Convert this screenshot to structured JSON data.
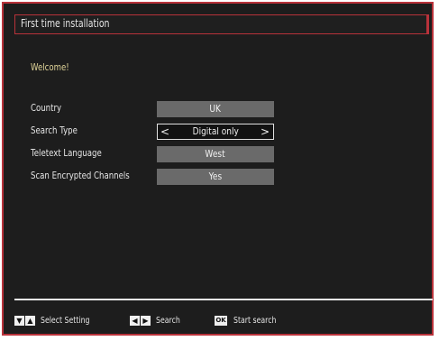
{
  "window": {
    "title": "First time installation",
    "welcome": "Welcome!"
  },
  "settings": [
    {
      "label": "Country",
      "value": "UK",
      "selected": false
    },
    {
      "label": "Search Type",
      "value": "Digital only",
      "selected": true,
      "arrow_left": "<",
      "arrow_right": ">"
    },
    {
      "label": "Teletext Language",
      "value": "West",
      "selected": false
    },
    {
      "label": "Scan Encrypted Channels",
      "value": "Yes",
      "selected": false
    }
  ],
  "footer": {
    "select_setting": {
      "keys": [
        "▼",
        "▲"
      ],
      "label": "Select Setting"
    },
    "search": {
      "keys": [
        "◀",
        "▶"
      ],
      "label": "Search"
    },
    "start_search": {
      "key": "OK",
      "label": "Start search"
    }
  },
  "colors": {
    "frame_border": "#b8323a",
    "background": "#1d1d1d",
    "welcome_text": "#e2d69a",
    "value_box": "#6a6a6a",
    "selected_box": "#121212"
  }
}
